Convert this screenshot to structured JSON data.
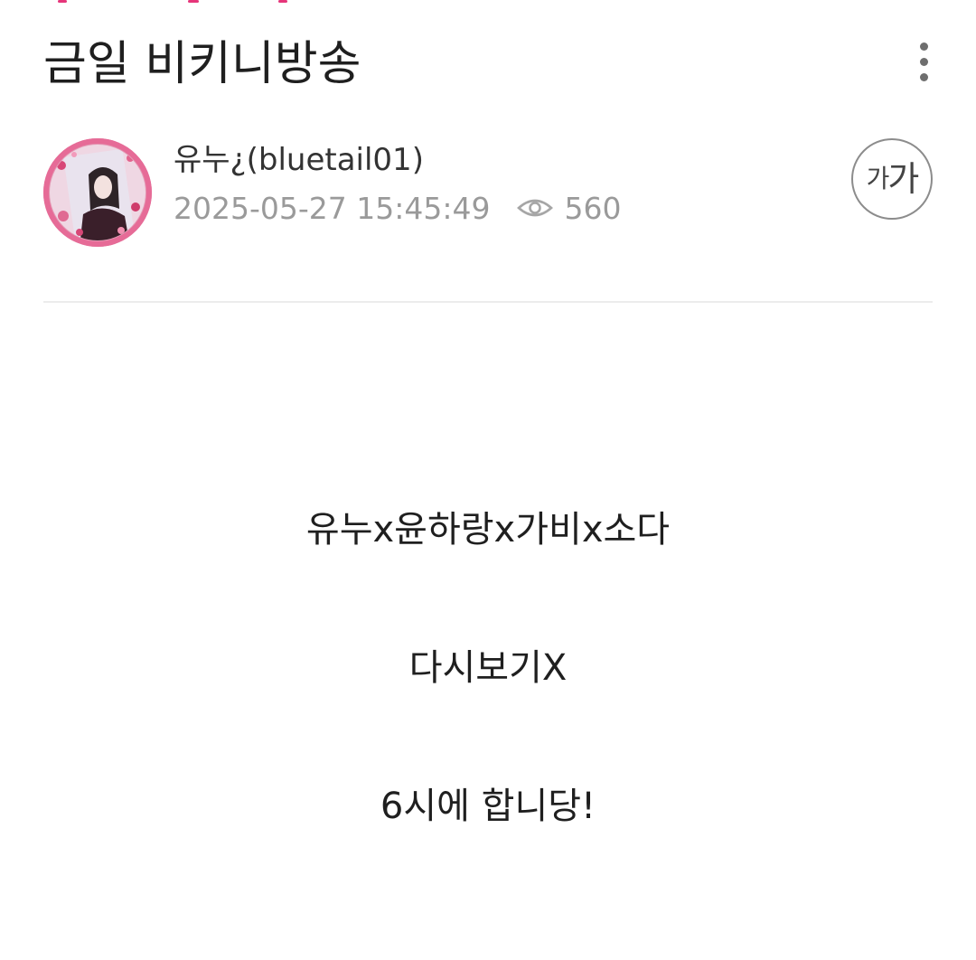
{
  "post": {
    "title": "금일 비키니방송"
  },
  "author": {
    "name": "유누¿(bluetail01)",
    "date": "2025-05-27 15:45:49",
    "views": "560"
  },
  "controls": {
    "font_size_small": "가",
    "font_size_large": "가",
    "more_icon": "more-vertical-icon",
    "views_icon": "eye-icon"
  },
  "body": {
    "lines": [
      "유누x윤하랑x가비x소다",
      "다시보기X",
      "6시에 합니당!"
    ]
  },
  "colors": {
    "title": "#1f1f1f",
    "meta": "#9a9a9a",
    "divider": "#ececec",
    "avatar_border": "#e66b97"
  }
}
